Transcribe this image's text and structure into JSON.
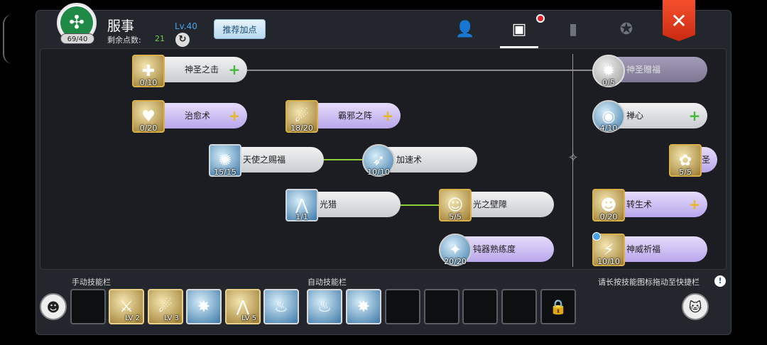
{
  "header": {
    "emblem_symbol": "✣",
    "emblem_count": "69/40",
    "job_title": "服事",
    "level": "Lv.40",
    "points_label": "剩余点数:",
    "points_value": "21",
    "recommend_button": "推荐加点"
  },
  "tabs": [
    {
      "icon": "character-icon",
      "glyph": "👤",
      "active": false
    },
    {
      "icon": "skill-book-icon",
      "glyph": "▣",
      "active": true,
      "notification": true
    },
    {
      "icon": "book-icon",
      "glyph": "▮",
      "active": false
    },
    {
      "icon": "guild-crest-icon",
      "glyph": "✪",
      "active": false
    }
  ],
  "close_glyph": "✕",
  "skills": {
    "holy_strike": {
      "name": "神圣之击",
      "count": "0/10",
      "glyph": "✚"
    },
    "heal": {
      "name": "治愈术",
      "count": "0/20",
      "glyph": "♥"
    },
    "evil_array": {
      "name": "霸邪之阵",
      "count": "18/20",
      "glyph": "☄"
    },
    "angel_blessing": {
      "name": "天使之赐福",
      "count": "15/15",
      "glyph": "✺"
    },
    "haste": {
      "name": "加速术",
      "count": "10/10",
      "glyph": "➶"
    },
    "light_hunt": {
      "name": "光猎",
      "count": "1/1",
      "glyph": "⋀"
    },
    "light_barrier": {
      "name": "光之壁障",
      "count": "5/5",
      "glyph": "☺"
    },
    "blunt_mastery": {
      "name": "钝器熟练度",
      "count": "20/20",
      "glyph": "✦"
    },
    "holy_gift": {
      "name": "神圣赠福",
      "count": "0/5",
      "glyph": "✹"
    },
    "zen_mind": {
      "name": "禅心",
      "count": "4/10",
      "glyph": "◉"
    },
    "saint": {
      "name": "圣",
      "count": "5/5",
      "glyph": "✿"
    },
    "rebirth": {
      "name": "转生术",
      "count": "0/20",
      "glyph": "☻"
    },
    "divine_prayer": {
      "name": "神威祈福",
      "count": "10/10",
      "glyph": "⚡"
    }
  },
  "bottom": {
    "manual_label": "手动技能栏",
    "auto_label": "自动技能栏",
    "hint": "请长按技能图标拖动至快捷栏",
    "hint_icon": "!",
    "left_face": "☻",
    "right_face": "🐱",
    "manual_slots": [
      {
        "glyph": "",
        "lv": ""
      },
      {
        "glyph": "⚔",
        "lv": "LV 2"
      },
      {
        "glyph": "☄",
        "lv": "LV 3"
      },
      {
        "glyph": "✸",
        "lv": ""
      },
      {
        "glyph": "⋀",
        "lv": "LV 5"
      },
      {
        "glyph": "♨",
        "lv": ""
      }
    ],
    "auto_slots": [
      {
        "glyph": "♨",
        "lv": ""
      },
      {
        "glyph": "✸",
        "lv": ""
      }
    ],
    "lock_glyph": "🔒"
  }
}
